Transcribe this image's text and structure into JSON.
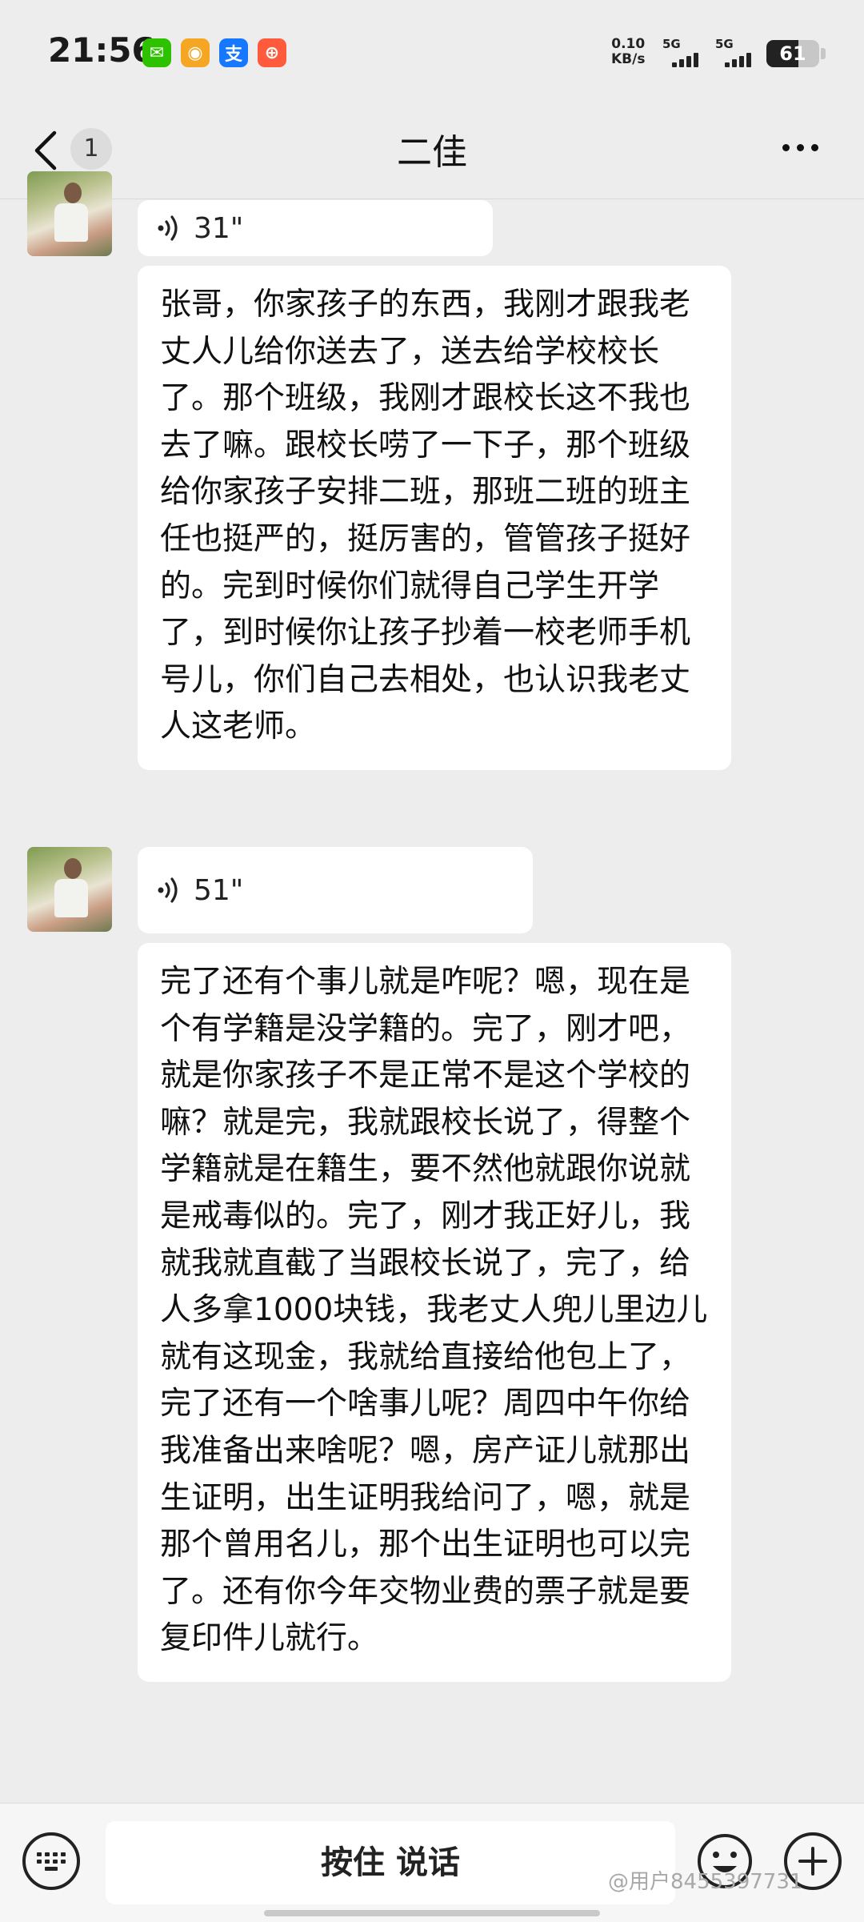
{
  "status_bar": {
    "time": "21:56",
    "net_speed_value": "0.10",
    "net_speed_unit": "KB/s",
    "signal1_label": "5G",
    "signal2_label": "5G",
    "battery": "61",
    "battery_level": 0.61,
    "app_icons": [
      {
        "name": "wechat-icon",
        "glyph": "✉",
        "color": "#2dc100"
      },
      {
        "name": "weibo-icon",
        "glyph": "◉",
        "color": "#f5a623"
      },
      {
        "name": "alipay-icon",
        "glyph": "支",
        "color": "#1677ff"
      },
      {
        "name": "xiaohongshu-icon",
        "glyph": "⊕",
        "color": "#ff5a3c"
      }
    ]
  },
  "nav": {
    "unread_count": "1",
    "title": "二佳"
  },
  "messages": [
    {
      "type": "voice",
      "duration": "31\""
    },
    {
      "type": "text",
      "text": "张哥，你家孩子的东西，我刚才跟我老丈人儿给你送去了，送去给学校校长了。那个班级，我刚才跟校长这不我也去了嘛。跟校长唠了一下子，那个班级给你家孩子安排二班，那班二班的班主任也挺严的，挺厉害的，管管孩子挺好的。完到时候你们就得自己学生开学了，到时候你让孩子抄着一校老师手机号儿，你们自己去相处，也认识我老丈人这老师。"
    },
    {
      "type": "voice",
      "duration": "51\""
    },
    {
      "type": "text",
      "text": "完了还有个事儿就是咋呢？嗯，现在是个有学籍是没学籍的。完了，刚才吧，就是你家孩子不是正常不是这个学校的嘛？就是完，我就跟校长说了，得整个学籍就是在籍生，要不然他就跟你说就是戒毒似的。完了，刚才我正好儿，我就我就直截了当跟校长说了，完了，给人多拿1000块钱，我老丈人兜儿里边儿就有这现金，我就给直接给他包上了，完了还有一个啥事儿呢？周四中午你给我准备出来啥呢？嗯，房产证儿就那出生证明，出生证明我给问了，嗯，就是那个曾用名儿，那个出生证明也可以完了。还有你今年交物业费的票子就是要复印件儿就行。"
    }
  ],
  "input_bar": {
    "hold_to_talk": "按住 说话"
  },
  "watermark": "@用户8455397731"
}
